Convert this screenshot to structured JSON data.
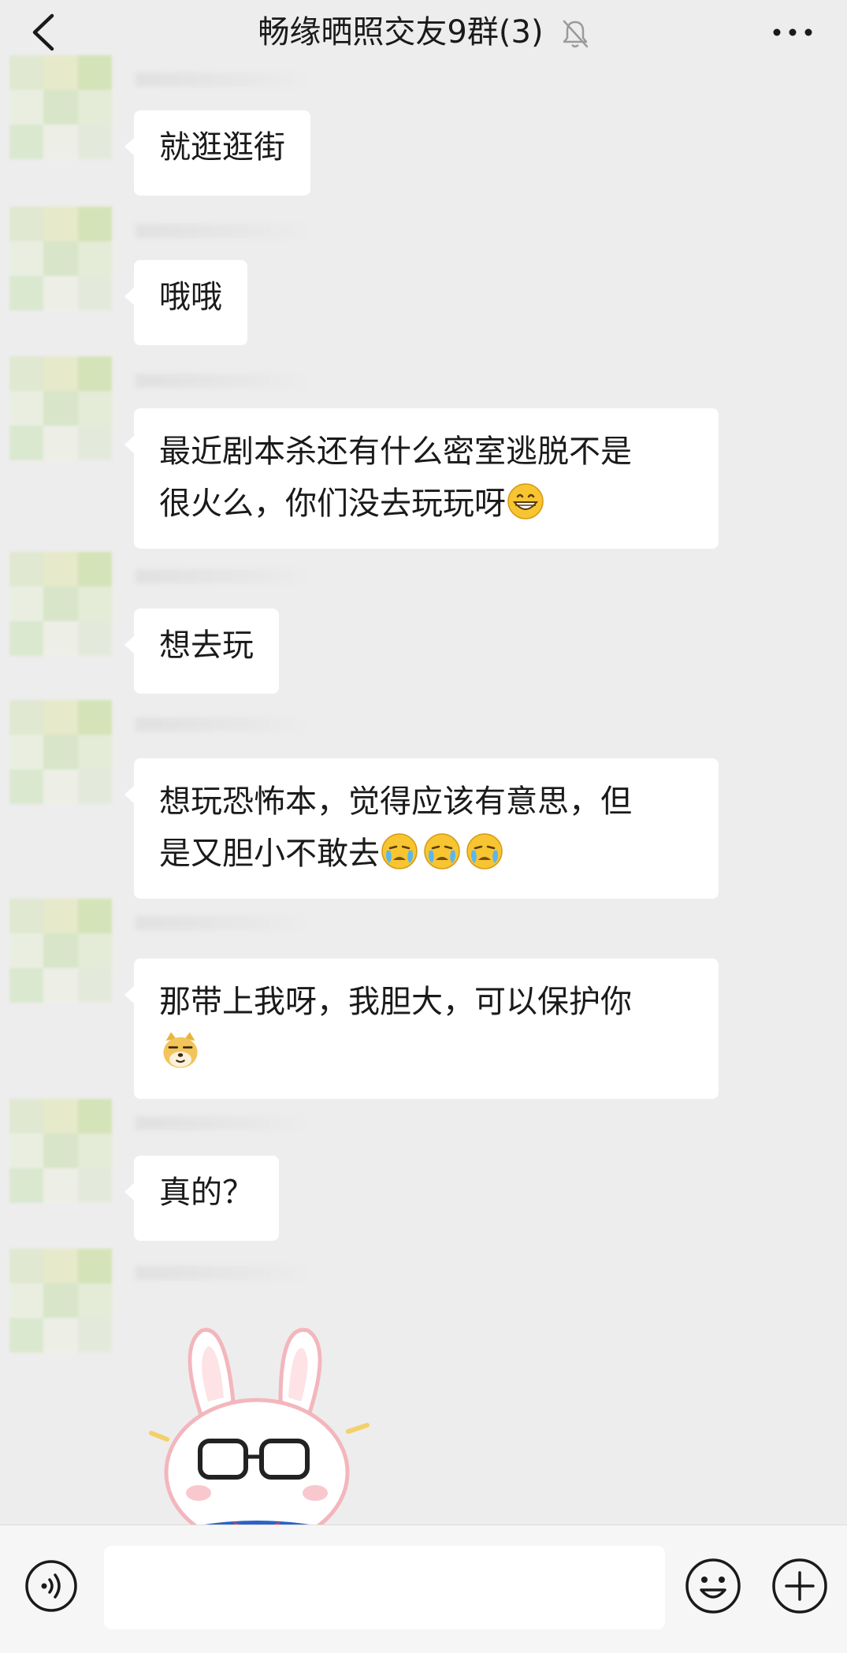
{
  "header": {
    "title": "畅缘晒照交友9群(3)",
    "back_icon": "chevron-left-icon",
    "mute_icon": "bell-off-icon",
    "more_icon": "more-dots-icon"
  },
  "messages": [
    {
      "text": "就逛逛街"
    },
    {
      "text": "哦哦"
    },
    {
      "line1": "最近剧本杀还有什么密室逃脱不是",
      "line2": "很火么，你们没去玩玩呀",
      "emoji": "grinning-face-icon"
    },
    {
      "text": "想去玩"
    },
    {
      "line1": "想玩恐怖本，觉得应该有意思，但",
      "line2": "是又胆小不敢去",
      "emoji": "crying-face-icon"
    },
    {
      "line1": "那带上我呀，我胆大，可以保护你",
      "emoji": "doge-icon"
    },
    {
      "text": "真的？"
    }
  ],
  "sticker": {
    "icon": "bunny-with-glasses-sticker"
  },
  "input_bar": {
    "voice_icon": "voice-icon",
    "emoji_icon": "smiley-icon",
    "plus_icon": "plus-circle-icon",
    "value": ""
  },
  "colors": {
    "background": "#ededed",
    "bubble": "#ffffff",
    "text": "#1a1a1a",
    "input_bar": "#f6f6f6"
  }
}
